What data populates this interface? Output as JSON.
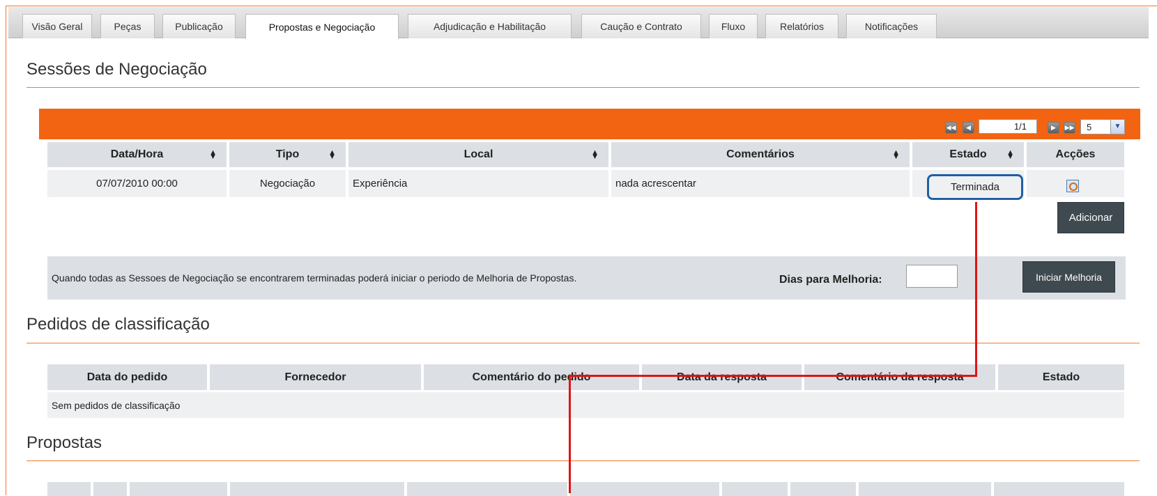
{
  "tabs": [
    {
      "label": "Visão Geral",
      "active": false
    },
    {
      "label": "Peças",
      "active": false
    },
    {
      "label": "Publicação",
      "active": false
    },
    {
      "label": "Propostas e Negociação",
      "active": true
    },
    {
      "label": "Adjudicação e Habilitação",
      "active": false
    },
    {
      "label": "Caução e Contrato",
      "active": false
    },
    {
      "label": "Fluxo",
      "active": false
    },
    {
      "label": "Relatórios",
      "active": false
    },
    {
      "label": "Notificações",
      "active": false
    }
  ],
  "sessions": {
    "title": "Sessões de Negociação",
    "pagination": {
      "page": "1/1",
      "page_size": "5",
      "first_icon": "first-page-icon",
      "prev_icon": "prev-page-icon",
      "next_icon": "next-page-icon",
      "last_icon": "last-page-icon"
    },
    "columns": [
      "Data/Hora",
      "Tipo",
      "Local",
      "Comentários",
      "Estado",
      "Acções"
    ],
    "rows": [
      {
        "datetime": "07/07/2010 00:00",
        "type": "Negociação",
        "local": "Experiência",
        "comments": "nada acrescentar",
        "status": "Terminada",
        "action_icon": "view-details-icon"
      }
    ],
    "add_button": "Adicionar",
    "info_text": "Quando todas as Sessoes de Negociação se encontrarem terminadas poderá iniciar o periodo de Melhoria de Propostas.",
    "days_label": "Dias para Melhoria:",
    "days_value": "",
    "start_button": "Iniciar Melhoria"
  },
  "classification": {
    "title": "Pedidos de classificação",
    "columns": [
      "Data do pedido",
      "Fornecedor",
      "Comentário do pedido",
      "Data da resposta",
      "Comentário da resposta",
      "Estado"
    ],
    "empty_text": "Sem pedidos de classificação"
  },
  "proposals": {
    "title": "Propostas"
  },
  "colors": {
    "accent_orange": "#f26411",
    "rule_orange": "#f07b2a",
    "header_gray": "#dce0e4",
    "highlight_blue": "#1f5fa6",
    "annotation_red": "#e01414"
  }
}
